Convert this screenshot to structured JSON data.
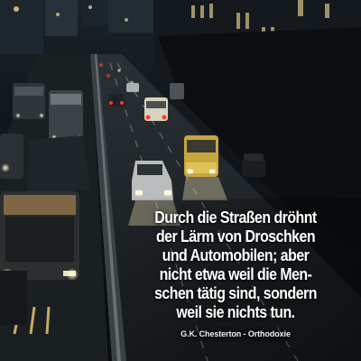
{
  "quote": {
    "lines": [
      "Durch die Straßen dröhnt",
      "der Lärm von Droschken",
      "und Automobilen; aber",
      "nicht etwa weil die Men-",
      "schen tätig sind, sondern",
      "weil sie nichts tun."
    ],
    "attribution": "G.K. Chesterton - Orthodoxie"
  },
  "colors": {
    "text": "#ffffff",
    "headlight": "#fff3c4",
    "taillight": "#ff3a24",
    "road": "#1b2024",
    "sky_dark": "#0b0f12"
  }
}
